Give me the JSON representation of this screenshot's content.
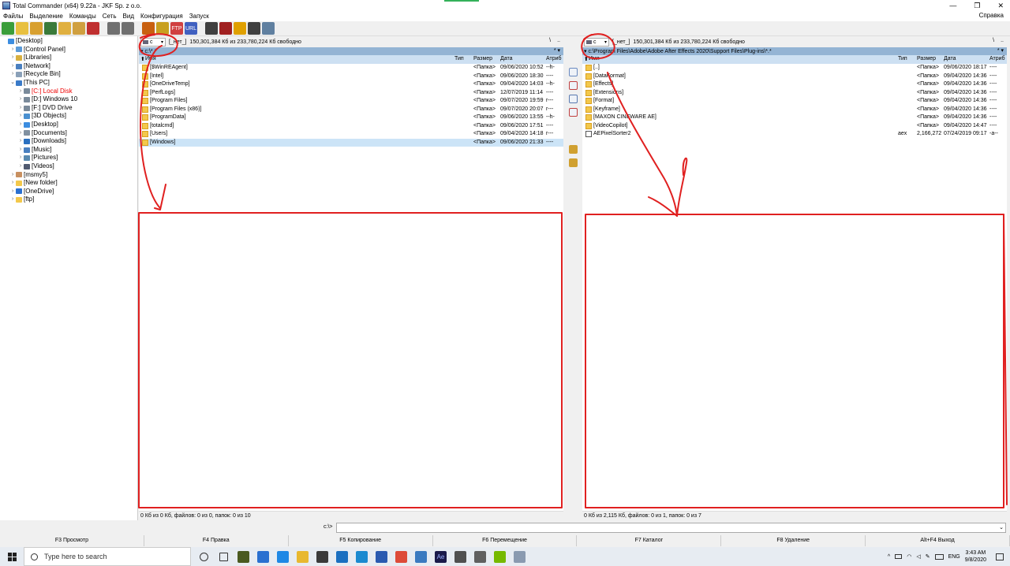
{
  "window": {
    "title": "Total Commander (x64) 9.22a - JKF Sp. z o.o.",
    "controls": [
      "—",
      "❐",
      "✕"
    ]
  },
  "menu": {
    "items": [
      "Файлы",
      "Выделение",
      "Команды",
      "Сеть",
      "Вид",
      "Конфигурация",
      "Запуск"
    ],
    "help": "Справка"
  },
  "toolbar": {
    "buttons": [
      {
        "icon": "refresh-icon",
        "color": "#3a9d3a"
      },
      {
        "icon": "brief-view-icon",
        "color": "#e8c040"
      },
      {
        "icon": "sort-icon",
        "color": "#d8a030"
      },
      {
        "icon": "thumbnails-icon",
        "color": "#3a7a3a"
      },
      {
        "icon": "tree-icon",
        "color": "#e0b040"
      },
      {
        "icon": "full-view-icon",
        "color": "#d0a040"
      },
      {
        "icon": "invert-icon",
        "color": "#c03030"
      },
      {
        "icon": "back-icon",
        "color": "#707070"
      },
      {
        "icon": "forward-icon",
        "color": "#707070"
      },
      {
        "icon": "pack-icon",
        "color": "#c86010"
      },
      {
        "icon": "unpack-icon",
        "color": "#c8a020"
      },
      {
        "icon": "ftp-icon",
        "color": "#d04040",
        "text": "FTP"
      },
      {
        "icon": "url-icon",
        "color": "#4060c0",
        "text": "URL"
      },
      {
        "icon": "find-icon",
        "color": "#404040"
      },
      {
        "icon": "rename-icon",
        "color": "#a02020"
      },
      {
        "icon": "sync-icon",
        "color": "#e0a000"
      },
      {
        "icon": "compare-icon",
        "color": "#404040"
      },
      {
        "icon": "notepad-icon",
        "color": "#6080a0"
      }
    ]
  },
  "tree": {
    "items": [
      {
        "label": "[Desktop]",
        "level": 0,
        "exp": "",
        "icon_color": "#3c8de0"
      },
      {
        "label": "[Control Panel]",
        "level": 1,
        "exp": ">",
        "icon_color": "#5a9ad8"
      },
      {
        "label": "[Libraries]",
        "level": 1,
        "exp": ">",
        "icon_color": "#d8b040"
      },
      {
        "label": "[Network]",
        "level": 1,
        "exp": ">",
        "icon_color": "#4a80c0"
      },
      {
        "label": "[Recycle Bin]",
        "level": 1,
        "exp": ">",
        "icon_color": "#8aa0b8"
      },
      {
        "label": "[This PC]",
        "level": 1,
        "exp": "v",
        "icon_color": "#3a7ac8"
      },
      {
        "label": "[C:]  Local Disk",
        "level": 2,
        "exp": ">",
        "icon_color": "#7a8a9a",
        "red": true
      },
      {
        "label": "[D:]  Windows 10",
        "level": 2,
        "exp": ">",
        "icon_color": "#7a8a9a"
      },
      {
        "label": "[F:]  DVD Drive",
        "level": 2,
        "exp": ">",
        "icon_color": "#7a8a9a"
      },
      {
        "label": "[3D Objects]",
        "level": 2,
        "exp": ">",
        "icon_color": "#4a90d0"
      },
      {
        "label": "[Desktop]",
        "level": 2,
        "exp": ">",
        "icon_color": "#3c8de0"
      },
      {
        "label": "[Documents]",
        "level": 2,
        "exp": ">",
        "icon_color": "#8090a0"
      },
      {
        "label": "[Downloads]",
        "level": 2,
        "exp": ">",
        "icon_color": "#2a70c0"
      },
      {
        "label": "[Music]",
        "level": 2,
        "exp": ">",
        "icon_color": "#4a80c0"
      },
      {
        "label": "[Pictures]",
        "level": 2,
        "exp": ">",
        "icon_color": "#5a8ab0"
      },
      {
        "label": "[Videos]",
        "level": 2,
        "exp": ">",
        "icon_color": "#505a70"
      },
      {
        "label": "[msmy5]",
        "level": 1,
        "exp": ">",
        "icon_color": "#c89060"
      },
      {
        "label": "[New folder]",
        "level": 1,
        "exp": ">",
        "icon_color": "#f3c84b"
      },
      {
        "label": "[OneDrive]",
        "level": 1,
        "exp": ">",
        "icon_color": "#2a70d0"
      },
      {
        "label": "[ftp]",
        "level": 1,
        "exp": ">",
        "icon_color": "#f3c84b"
      }
    ]
  },
  "left_panel": {
    "drive": "c",
    "volume": "[_нет_]",
    "free_space": "150,301,384 Кб из 233,780,224 Кб свободно",
    "drive_right": [
      "\\",
      ".."
    ],
    "path": "c:\\*.*",
    "path_right": "* ▾",
    "columns": {
      "name": "Имя",
      "type": "Тип",
      "size": "Размер",
      "date": "Дата",
      "attr": "Атриб"
    },
    "rows": [
      {
        "name": "[$WinREAgent]",
        "type": "",
        "size": "<Папка>",
        "date": "09/06/2020 10:52",
        "attr": "--h-"
      },
      {
        "name": "[Intel]",
        "type": "",
        "size": "<Папка>",
        "date": "09/06/2020 18:30",
        "attr": "----"
      },
      {
        "name": "[OneDriveTemp]",
        "type": "",
        "size": "<Папка>",
        "date": "09/04/2020 14:03",
        "attr": "--h-"
      },
      {
        "name": "[PerfLogs]",
        "type": "",
        "size": "<Папка>",
        "date": "12/07/2019 11:14",
        "attr": "----"
      },
      {
        "name": "[Program Files]",
        "type": "",
        "size": "<Папка>",
        "date": "09/07/2020 19:59",
        "attr": "r---"
      },
      {
        "name": "[Program Files (x86)]",
        "type": "",
        "size": "<Папка>",
        "date": "09/07/2020 20:07",
        "attr": "r---"
      },
      {
        "name": "[ProgramData]",
        "type": "",
        "size": "<Папка>",
        "date": "09/06/2020 13:55",
        "attr": "--h-"
      },
      {
        "name": "[totalcmd]",
        "type": "",
        "size": "<Папка>",
        "date": "09/06/2020 17:51",
        "attr": "----"
      },
      {
        "name": "[Users]",
        "type": "",
        "size": "<Папка>",
        "date": "09/04/2020 14:18",
        "attr": "r---"
      },
      {
        "name": "[Windows]",
        "type": "",
        "size": "<Папка>",
        "date": "09/06/2020 21:33",
        "attr": "----",
        "selected": true
      }
    ],
    "status": "0 Кб из 0 Кб, файлов: 0 из 0, папок: 0 из 10"
  },
  "right_panel": {
    "drive": "c",
    "volume": "[_нет_]",
    "free_space": "150,301,384 Кб из 233,780,224 Кб свободно",
    "drive_right": [
      "\\",
      ".."
    ],
    "path": "c:\\Program Files\\Adobe\\Adobe After Effects 2020\\Support Files\\Plug-ins\\*.*",
    "path_right": "* ▾",
    "columns": {
      "name": "Имя",
      "type": "Тип",
      "size": "Размер",
      "date": "Дата",
      "attr": "Атриб"
    },
    "rows": [
      {
        "name": "[..]",
        "type": "",
        "size": "<Папка>",
        "date": "09/06/2020 18:17",
        "attr": "----",
        "up": true
      },
      {
        "name": "[DataFormat]",
        "type": "",
        "size": "<Папка>",
        "date": "09/04/2020 14:36",
        "attr": "----"
      },
      {
        "name": "[Effects]",
        "type": "",
        "size": "<Папка>",
        "date": "09/04/2020 14:36",
        "attr": "----"
      },
      {
        "name": "[Extensions]",
        "type": "",
        "size": "<Папка>",
        "date": "09/04/2020 14:36",
        "attr": "----"
      },
      {
        "name": "[Format]",
        "type": "",
        "size": "<Папка>",
        "date": "09/04/2020 14:36",
        "attr": "----"
      },
      {
        "name": "[Keyframe]",
        "type": "",
        "size": "<Папка>",
        "date": "09/04/2020 14:36",
        "attr": "----"
      },
      {
        "name": "[MAXON CINEWARE AE]",
        "type": "",
        "size": "<Папка>",
        "date": "09/04/2020 14:36",
        "attr": "----"
      },
      {
        "name": "[VideoCopilot]",
        "type": "",
        "size": "<Папка>",
        "date": "09/04/2020 14:47",
        "attr": "----"
      },
      {
        "name": "AEPixelSorter2",
        "type": "aex",
        "size": "2,166,272",
        "date": "07/24/2019 09:17",
        "attr": "-a--",
        "file": true
      }
    ],
    "status": "0 Кб из 2,115 Кб, файлов: 0 из 1, папок: 0 из 7"
  },
  "middle_buttons": [
    {
      "icon": "view-icon",
      "color": "#6a8ac0"
    },
    {
      "icon": "edit-icon",
      "color": "#c04040"
    },
    {
      "icon": "copy-icon",
      "color": "#5a7ab0"
    },
    {
      "icon": "move-icon",
      "color": "#c04040"
    },
    {
      "icon": "new-folder-icon",
      "color": "#d0a030"
    },
    {
      "icon": "delete-icon",
      "color": "#d0a030"
    }
  ],
  "command_line": {
    "prompt": "c:\\>",
    "value": ""
  },
  "function_keys": [
    "F3 Просмотр",
    "F4 Правка",
    "F5 Копирование",
    "F6 Перемещение",
    "F7 Каталог",
    "F8 Удаление",
    "Alt+F4 Выход"
  ],
  "taskbar": {
    "search_placeholder": "Type here to search",
    "apps": [
      {
        "icon": "cortana-icon",
        "color": "#333333"
      },
      {
        "icon": "task-view-icon",
        "color": "#333333"
      },
      {
        "icon": "sticky-notes-icon",
        "color": "#4a5a20"
      },
      {
        "icon": "todo-icon",
        "color": "#2a70d0"
      },
      {
        "icon": "edge-icon",
        "color": "#1e88e5"
      },
      {
        "icon": "file-explorer-icon",
        "color": "#e8b830"
      },
      {
        "icon": "store-icon",
        "color": "#3a3a3a"
      },
      {
        "icon": "mail-icon",
        "color": "#1a6fc0"
      },
      {
        "icon": "skype-icon",
        "color": "#1a8ad0"
      },
      {
        "icon": "save-icon",
        "color": "#2a5ab0"
      },
      {
        "icon": "chrome-icon",
        "color": "#dd4b39"
      },
      {
        "icon": "total-commander-icon",
        "color": "#3a7ac0"
      },
      {
        "icon": "after-effects-icon",
        "color": "#1a1a4a",
        "text": "Ae"
      },
      {
        "icon": "photos-icon",
        "color": "#505050"
      },
      {
        "icon": "settings-icon",
        "color": "#606060"
      },
      {
        "icon": "nvidia-icon",
        "color": "#76b900"
      },
      {
        "icon": "window-icon",
        "color": "#8a9ab0"
      }
    ],
    "tray_lang": "ENG",
    "time": "3:43 AM",
    "date": "9/8/2020"
  }
}
